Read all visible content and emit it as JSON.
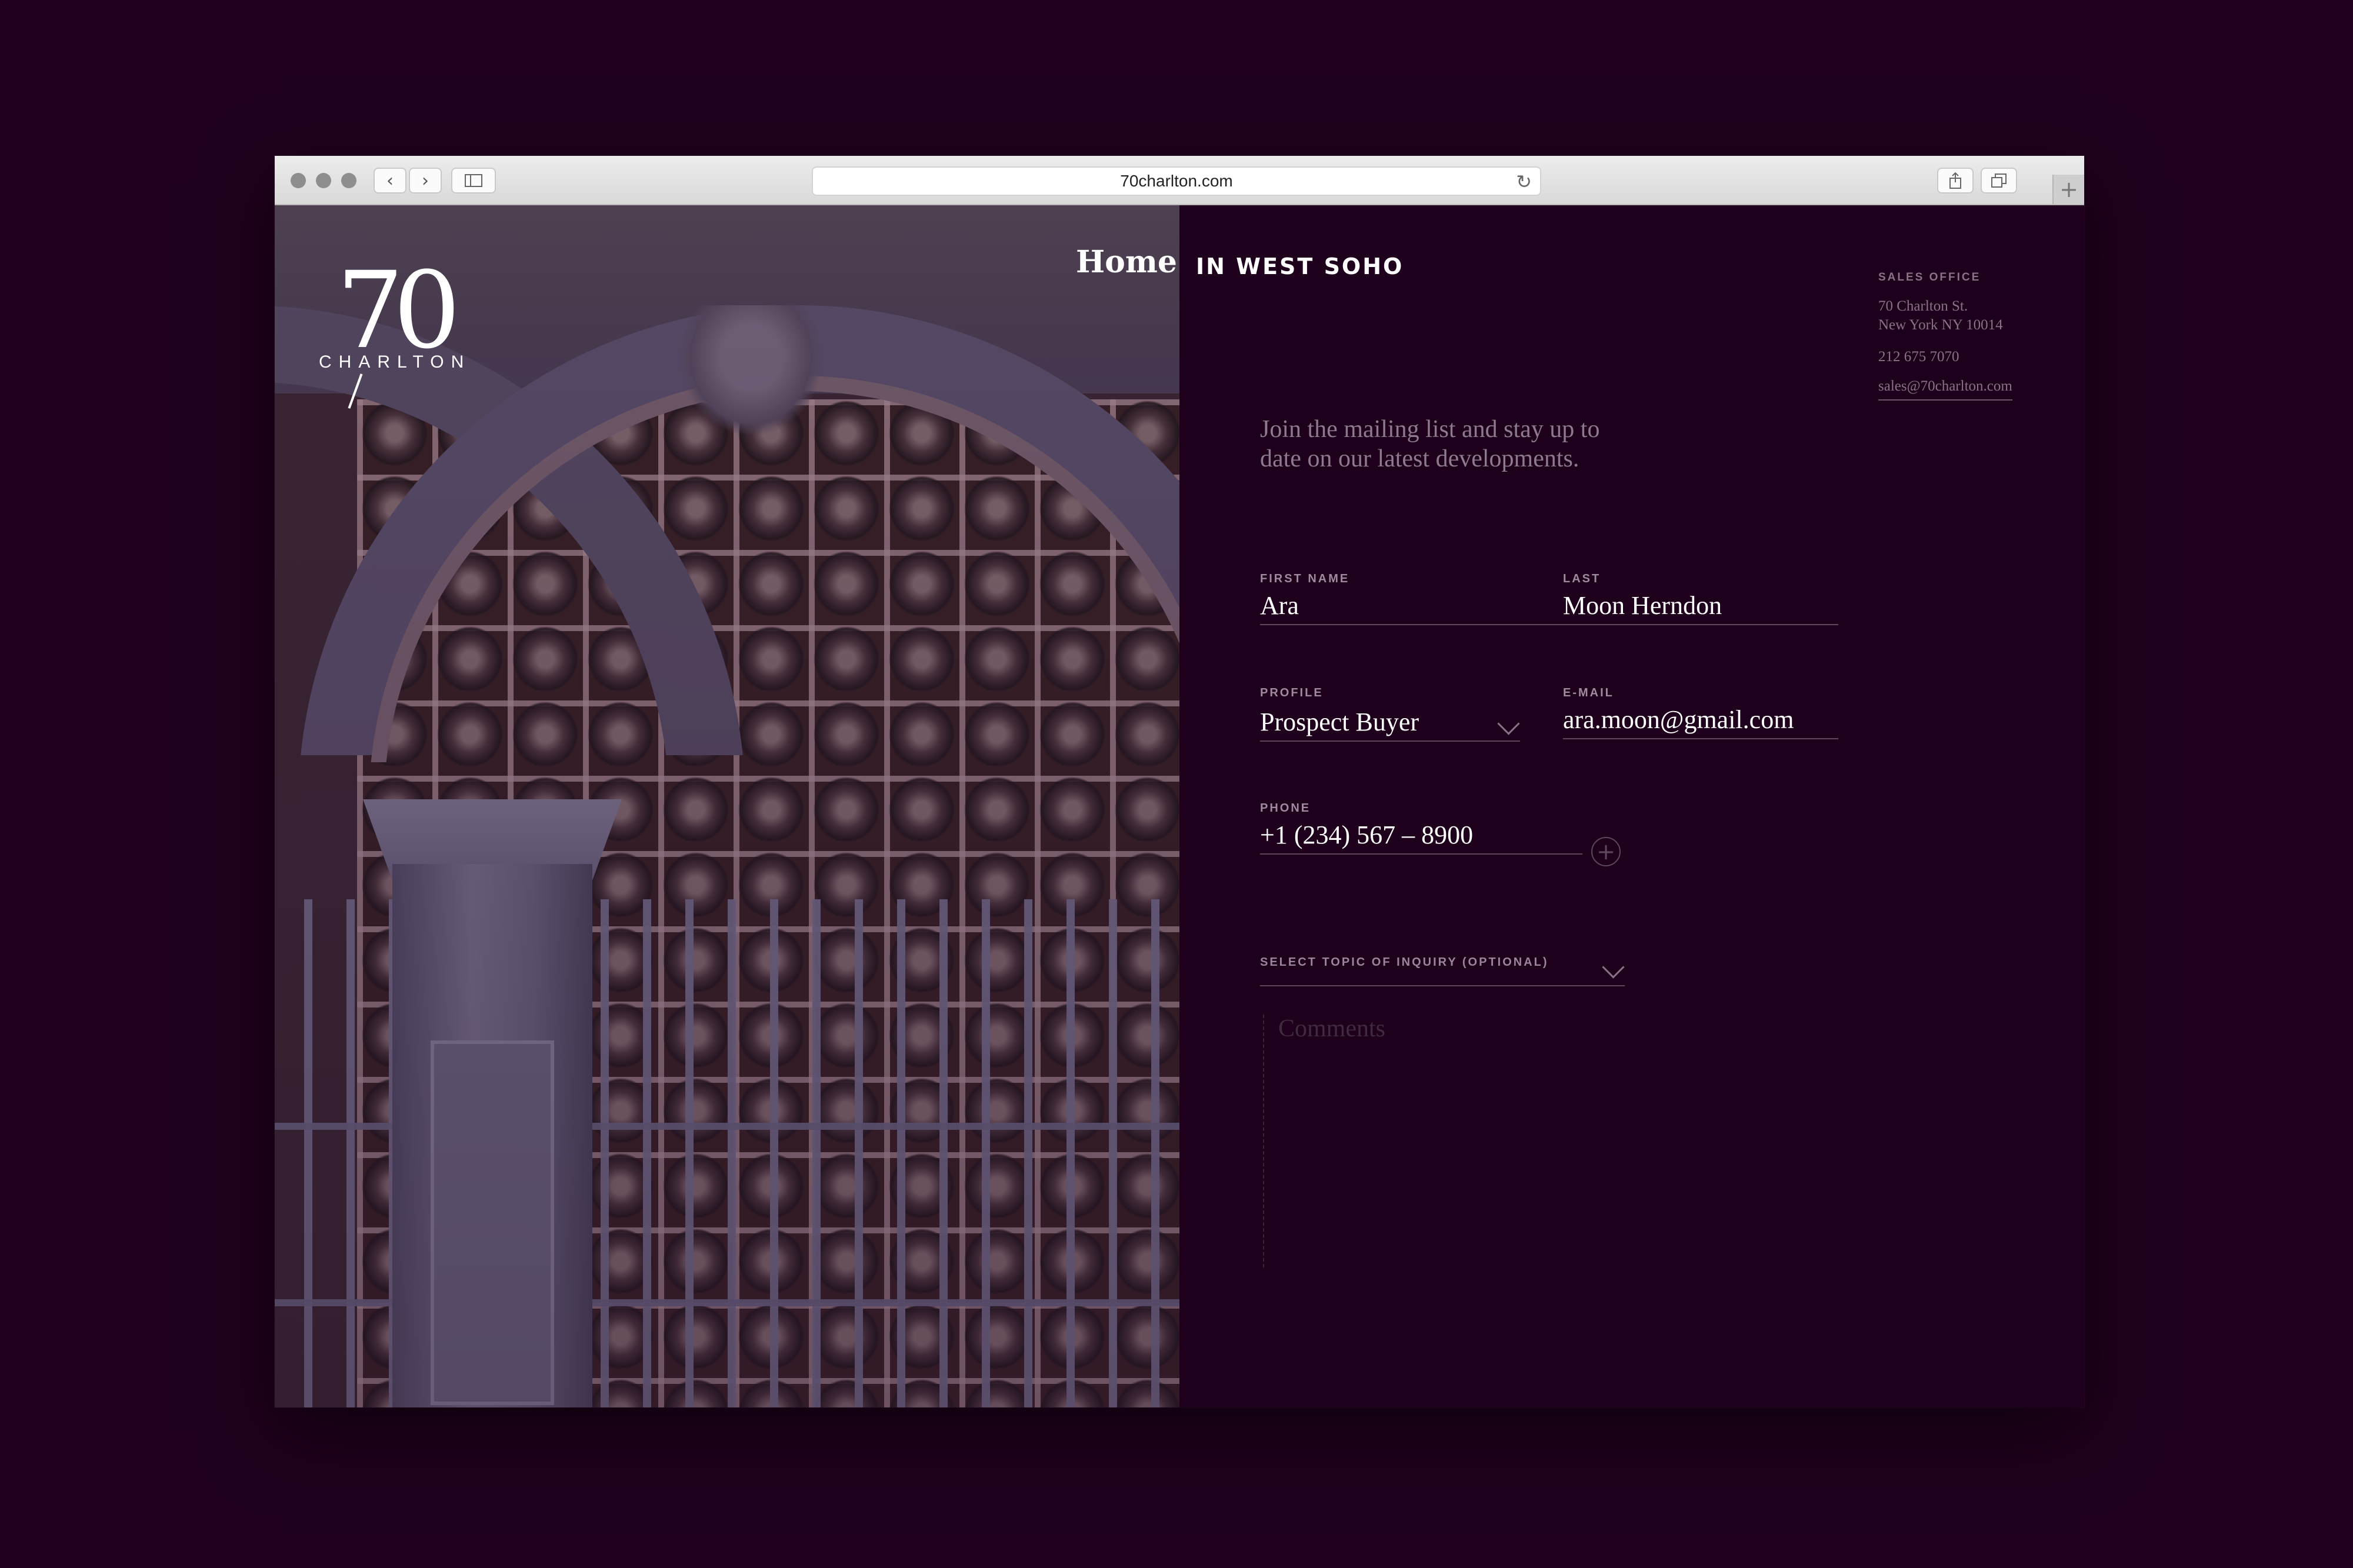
{
  "browser": {
    "url": "70charlton.com"
  },
  "brand": {
    "logo_number": "70",
    "logo_word": "CHARLTON"
  },
  "nav": {
    "home": "Home",
    "tagline": "IN WEST SOHO"
  },
  "sales_office": {
    "title": "SALES OFFICE",
    "address_line1": "70 Charlton St.",
    "address_line2": "New York NY 10014",
    "phone": "212 675 7070",
    "email": "sales@70charlton.com"
  },
  "form": {
    "intro": "Join the mailing list and stay up to date on our latest developments.",
    "first_name": {
      "label": "FIRST NAME",
      "value": "Ara"
    },
    "last_name": {
      "label": "LAST",
      "value": "Moon Herndon"
    },
    "profile": {
      "label": "PROFILE",
      "value": "Prospect Buyer"
    },
    "email": {
      "label": "E-MAIL",
      "value": "ara.moon@gmail.com"
    },
    "phone": {
      "label": "PHONE",
      "value": "+1 (234) 567 – 8900"
    },
    "topic": {
      "placeholder": "SELECT TOPIC OF INQUIRY (OPTIONAL)"
    },
    "comments": {
      "placeholder": "Comments"
    }
  },
  "colors": {
    "page_background": "#20001d",
    "panel_background": "#1e001c",
    "muted_text": "#8a7186",
    "rule": "#5f475c"
  },
  "icons": [
    "back-icon",
    "forward-icon",
    "sidebar-icon",
    "reload-icon",
    "share-icon",
    "tabs-icon",
    "plus-icon",
    "chevron-down-icon",
    "add-circle-icon"
  ]
}
